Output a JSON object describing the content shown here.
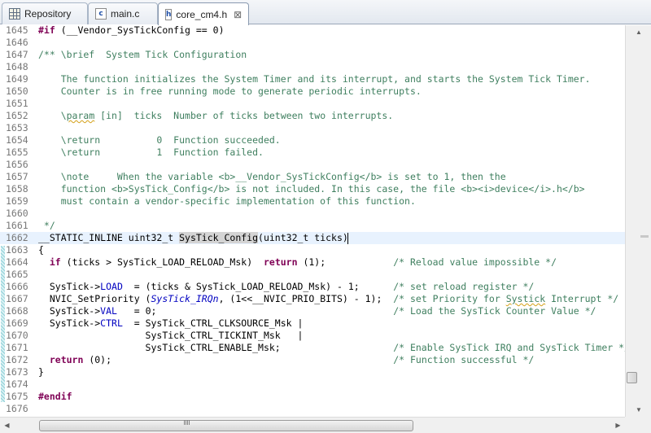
{
  "tabs": [
    {
      "label": "Repository",
      "icon": "repository-icon"
    },
    {
      "label": "main.c",
      "icon": "c-file-icon"
    },
    {
      "label": "core_cm4.h",
      "icon": "h-file-icon",
      "close": "⊠"
    }
  ],
  "icons": {
    "c_file_letter": "c",
    "h_file_letter": "h"
  },
  "editor": {
    "lines": [
      {
        "num": "1645",
        "segs": [
          {
            "t": "#if",
            "c": "kw"
          },
          {
            "t": " (__Vendor_SysTickConfig == 0)"
          }
        ]
      },
      {
        "num": "1646",
        "segs": []
      },
      {
        "num": "1647",
        "segs": [
          {
            "t": "/** \\brief  System Tick Configuration",
            "c": "cm"
          }
        ]
      },
      {
        "num": "1648",
        "segs": []
      },
      {
        "num": "1649",
        "segs": [
          {
            "t": "    The function initializes the System Timer and its interrupt, and starts the System Tick Timer.",
            "c": "cm"
          }
        ]
      },
      {
        "num": "1650",
        "segs": [
          {
            "t": "    Counter is in free running mode to generate periodic interrupts.",
            "c": "cm"
          }
        ]
      },
      {
        "num": "1651",
        "segs": []
      },
      {
        "num": "1652",
        "segs": [
          {
            "t": "    \\",
            "c": "cm"
          },
          {
            "t": "param",
            "c": "cm sq"
          },
          {
            "t": " [in]  ticks  Number of ticks between two interrupts.",
            "c": "cm"
          }
        ]
      },
      {
        "num": "1653",
        "segs": []
      },
      {
        "num": "1654",
        "segs": [
          {
            "t": "    \\return          0  Function succeeded.",
            "c": "cm"
          }
        ]
      },
      {
        "num": "1655",
        "segs": [
          {
            "t": "    \\return          1  Function failed.",
            "c": "cm"
          }
        ]
      },
      {
        "num": "1656",
        "segs": []
      },
      {
        "num": "1657",
        "segs": [
          {
            "t": "    \\note     When the variable <b>__Vendor_SysTickConfig</b> is set to 1, then the",
            "c": "cm"
          }
        ]
      },
      {
        "num": "1658",
        "segs": [
          {
            "t": "    function <b>SysTick_Config</b> is not included. In this case, the file <b><i>device</i>.h</b>",
            "c": "cm"
          }
        ]
      },
      {
        "num": "1659",
        "segs": [
          {
            "t": "    must contain a vendor-specific implementation of this function.",
            "c": "cm"
          }
        ]
      },
      {
        "num": "1660",
        "segs": []
      },
      {
        "num": "1661",
        "segs": [
          {
            "t": " */",
            "c": "cm"
          }
        ]
      },
      {
        "num": "1662",
        "current": true,
        "segs": [
          {
            "t": "__STATIC_INLINE uint32_t "
          },
          {
            "t": "SysTick_Config",
            "c": "hl"
          },
          {
            "t": "(uint32_t ticks)"
          },
          {
            "caret": true
          }
        ]
      },
      {
        "num": "1663",
        "segs": [
          {
            "t": "{"
          }
        ]
      },
      {
        "num": "1664",
        "segs": [
          {
            "t": "  "
          },
          {
            "t": "if",
            "c": "kw"
          },
          {
            "t": " (ticks > SysTick_LOAD_RELOAD_Msk)  "
          },
          {
            "t": "return",
            "c": "kw"
          },
          {
            "t": " (1);            "
          },
          {
            "t": "/* Reload value impossible */",
            "c": "cm"
          }
        ]
      },
      {
        "num": "1665",
        "segs": []
      },
      {
        "num": "1666",
        "segs": [
          {
            "t": "  SysTick->"
          },
          {
            "t": "LOAD",
            "c": "fld"
          },
          {
            "t": "  = (ticks & SysTick_LOAD_RELOAD_Msk) - 1;      "
          },
          {
            "t": "/* set reload register */",
            "c": "cm"
          }
        ]
      },
      {
        "num": "1667",
        "segs": [
          {
            "t": "  NVIC_SetPriority ("
          },
          {
            "t": "SysTick_IRQn",
            "c": "it"
          },
          {
            "t": ", (1<<__NVIC_PRIO_BITS) - 1);  "
          },
          {
            "t": "/* set Priority for ",
            "c": "cm"
          },
          {
            "t": "Systick",
            "c": "cm sq"
          },
          {
            "t": " Interrupt */",
            "c": "cm"
          }
        ]
      },
      {
        "num": "1668",
        "segs": [
          {
            "t": "  SysTick->"
          },
          {
            "t": "VAL",
            "c": "fld"
          },
          {
            "t": "   = 0;                                          "
          },
          {
            "t": "/* Load the SysTick Counter Value */",
            "c": "cm"
          }
        ]
      },
      {
        "num": "1669",
        "segs": [
          {
            "t": "  SysTick->"
          },
          {
            "t": "CTRL",
            "c": "fld"
          },
          {
            "t": "  = SysTick_CTRL_CLKSOURCE_Msk |"
          }
        ]
      },
      {
        "num": "1670",
        "segs": [
          {
            "t": "                   SysTick_CTRL_TICKINT_Msk   |"
          }
        ]
      },
      {
        "num": "1671",
        "segs": [
          {
            "t": "                   SysTick_CTRL_ENABLE_Msk;                    "
          },
          {
            "t": "/* Enable SysTick IRQ and SysTick Timer */",
            "c": "cm"
          }
        ]
      },
      {
        "num": "1672",
        "segs": [
          {
            "t": "  "
          },
          {
            "t": "return",
            "c": "kw"
          },
          {
            "t": " (0);                                                  "
          },
          {
            "t": "/* Function successful */",
            "c": "cm"
          }
        ]
      },
      {
        "num": "1673",
        "segs": [
          {
            "t": "}"
          }
        ]
      },
      {
        "num": "1674",
        "segs": []
      },
      {
        "num": "1675",
        "segs": [
          {
            "t": "#endif",
            "c": "kw"
          }
        ]
      },
      {
        "num": "1676",
        "segs": []
      }
    ]
  },
  "scroll": {
    "vertical_position": 0.93,
    "horizontal_position": 0.0
  }
}
